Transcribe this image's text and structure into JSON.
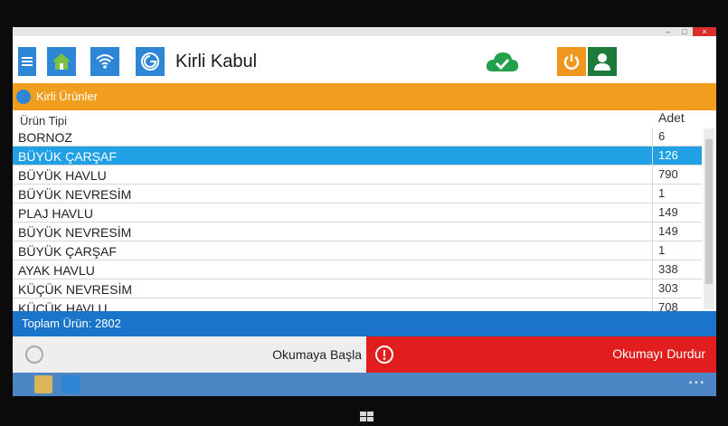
{
  "app": {
    "title": "Kirli Kabul"
  },
  "window_controls": {
    "minimize": "–",
    "maximize": "□",
    "close": "×"
  },
  "section": {
    "title": "Kirli Ürünler"
  },
  "table": {
    "headers": {
      "type": "Ürün Tipi",
      "qty": "Adet"
    },
    "rows": [
      {
        "name": "BORNOZ",
        "qty": "6"
      },
      {
        "name": "BÜYÜK ÇARŞAF",
        "qty": "126",
        "selected": true
      },
      {
        "name": "BÜYÜK HAVLU",
        "qty": "790"
      },
      {
        "name": "BÜYÜK NEVRESİM",
        "qty": "1"
      },
      {
        "name": "PLAJ HAVLU",
        "qty": "149"
      },
      {
        "name": "BÜYÜK NEVRESİM",
        "qty": "149"
      },
      {
        "name": "BÜYÜK ÇARŞAF",
        "qty": "1"
      },
      {
        "name": "AYAK HAVLU",
        "qty": "338"
      },
      {
        "name": "KÜÇÜK NEVRESİM",
        "qty": "303"
      },
      {
        "name": "KÜÇÜK HAVLU",
        "qty": "708"
      }
    ]
  },
  "summary": {
    "total": "Toplam Ürün: 2802"
  },
  "actions": {
    "start_label": "Okumaya Başla",
    "stop_label": "Okumayı Durdur"
  },
  "colors": {
    "accent_blue": "#2d86d6",
    "section_orange": "#f19d1e",
    "selected_row": "#22a0e6",
    "total_bar": "#1a74c9",
    "stop_red": "#e11d1d",
    "sync_green": "#22a04a"
  },
  "icons": {
    "menu": "menu-icon",
    "home": "home-icon",
    "wifi": "wifi-icon",
    "app": "app-logo-icon",
    "sync": "cloud-check-icon",
    "power": "power-icon",
    "user": "user-icon",
    "play": "play-icon",
    "stop": "stop-icon"
  }
}
